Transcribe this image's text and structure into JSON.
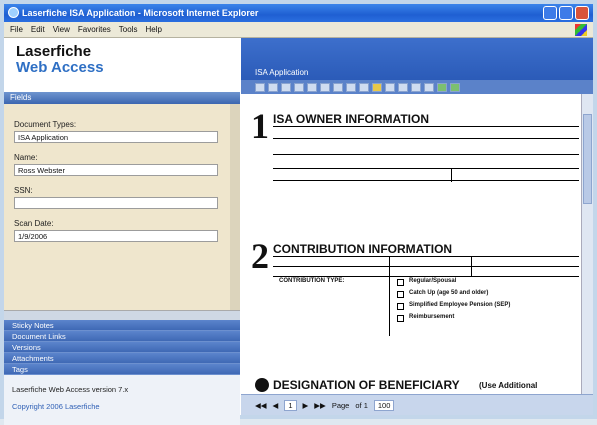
{
  "window": {
    "title": "Laserfiche ISA Application - Microsoft Internet Explorer"
  },
  "menu": [
    "File",
    "Edit",
    "View",
    "Favorites",
    "Tools",
    "Help"
  ],
  "logo": {
    "line1": "Laserfiche",
    "line2": "Web Access"
  },
  "fields_panel": {
    "header": "Fields",
    "fields": [
      {
        "label": "Document Types:",
        "value": "ISA Application"
      },
      {
        "label": "Name:",
        "value": "Ross Webster"
      },
      {
        "label": "SSN:",
        "value": ""
      },
      {
        "label": "Scan Date:",
        "value": "1/9/2006"
      }
    ]
  },
  "nav_sections": [
    "Sticky Notes",
    "Document Links",
    "Versions",
    "Attachments",
    "Tags"
  ],
  "footer": {
    "version": "Laserfiche Web Access version 7.x",
    "copyright": "Copyright 2006 Laserfiche"
  },
  "viewer": {
    "title": "ISA Application",
    "sections": [
      {
        "num": "1",
        "title": "ISA OWNER INFORMATION"
      },
      {
        "num": "2",
        "title": "CONTRIBUTION INFORMATION"
      },
      {
        "num": "",
        "title": "DESIGNATION OF BENEFICIARY",
        "note": "(Use Additional"
      }
    ],
    "contribution_type_label": "CONTRIBUTION TYPE:",
    "contribution_options": [
      "Regular/Spousal",
      "Catch Up (age 50 and older)",
      "Simplified Employee Pension (SEP)",
      "Reimbursement"
    ],
    "status": {
      "page_label": "Page",
      "page": "1",
      "of": "of 1",
      "zoom": "100"
    }
  },
  "colors": {
    "accent": "#2e6fc4",
    "titlebar": "#1f5fd2",
    "fields_bg": "#efe6cd"
  }
}
